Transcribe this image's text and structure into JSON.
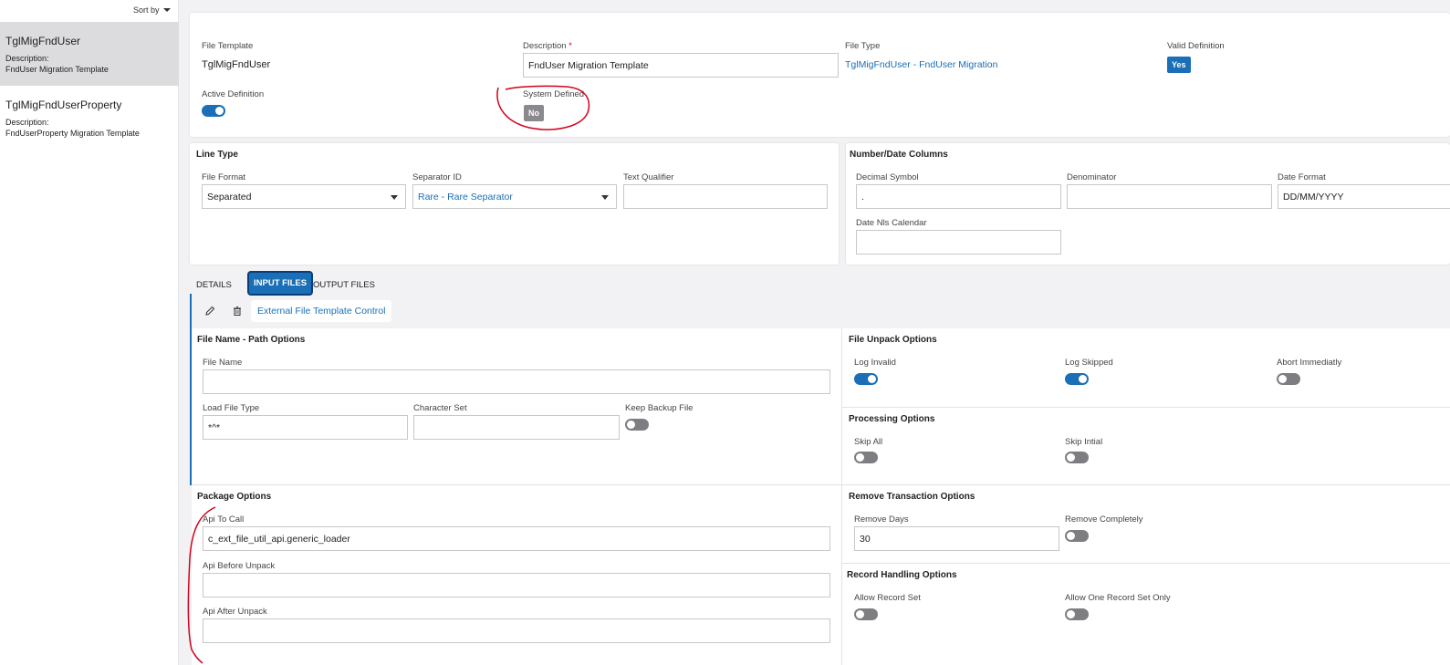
{
  "sidebar": {
    "sort_label": "Sort by",
    "items": [
      {
        "title": "TglMigFndUser",
        "desc_label": "Description:",
        "desc": "FndUser Migration Template"
      },
      {
        "title": "TglMigFndUserProperty",
        "desc_label": "Description:",
        "desc": "FndUserProperty Migration Template"
      }
    ]
  },
  "header": {
    "file_template_label": "File Template",
    "file_template_value": "TglMigFndUser",
    "description_label": "Description",
    "description_required": "*",
    "description_value": "FndUser Migration Template",
    "file_type_label": "File Type",
    "file_type_value": "TglMigFndUser - FndUser Migration",
    "valid_definition_label": "Valid Definition",
    "valid_definition_value": "Yes",
    "active_definition_label": "Active Definition",
    "system_defined_label": "System Defined",
    "system_defined_value": "No"
  },
  "line_type": {
    "title": "Line Type",
    "file_format_label": "File Format",
    "file_format_value": "Separated",
    "separator_label": "Separator ID",
    "separator_value": "Rare - Rare Separator",
    "text_qualifier_label": "Text Qualifier",
    "text_qualifier_value": ""
  },
  "number_date": {
    "title": "Number/Date Columns",
    "decimal_label": "Decimal Symbol",
    "decimal_value": ".",
    "denominator_label": "Denominator",
    "denominator_value": "",
    "date_format_label": "Date Format",
    "date_format_value": "DD/MM/YYYY",
    "nls_label": "Date Nls Calendar",
    "nls_value": ""
  },
  "tabs": [
    {
      "label": "DETAILS"
    },
    {
      "label": "INPUT FILES"
    },
    {
      "label": "OUTPUT FILES"
    }
  ],
  "toolbar": {
    "control_label": "External File Template Control"
  },
  "file_name": {
    "title": "File Name - Path Options",
    "file_name_label": "File Name",
    "file_name_value": "",
    "load_type_label": "Load File Type",
    "load_type_value": "*^*",
    "charset_label": "Character Set",
    "charset_value": "",
    "keep_backup_label": "Keep Backup File"
  },
  "unpack": {
    "title": "File Unpack Options",
    "log_invalid_label": "Log Invalid",
    "log_skipped_label": "Log Skipped",
    "abort_label": "Abort Immediatly"
  },
  "processing": {
    "title": "Processing Options",
    "skip_all_label": "Skip All",
    "skip_initial_label": "Skip Intial"
  },
  "package": {
    "title": "Package Options",
    "api_call_label": "Api To Call",
    "api_call_value": "c_ext_file_util_api.generic_loader",
    "api_before_label": "Api Before Unpack",
    "api_before_value": "",
    "api_after_label": "Api After Unpack",
    "api_after_value": ""
  },
  "remove": {
    "title": "Remove Transaction Options",
    "days_label": "Remove Days",
    "days_value": "30",
    "completely_label": "Remove Completely"
  },
  "record": {
    "title": "Record Handling Options",
    "allow_set_label": "Allow Record Set",
    "allow_one_label": "Allow One Record Set Only"
  },
  "colors": {
    "accent": "#1a6fb6",
    "annotation": "#d0021b"
  },
  "icons": [
    "pencil-icon",
    "trash-icon",
    "chevron-down-icon"
  ]
}
